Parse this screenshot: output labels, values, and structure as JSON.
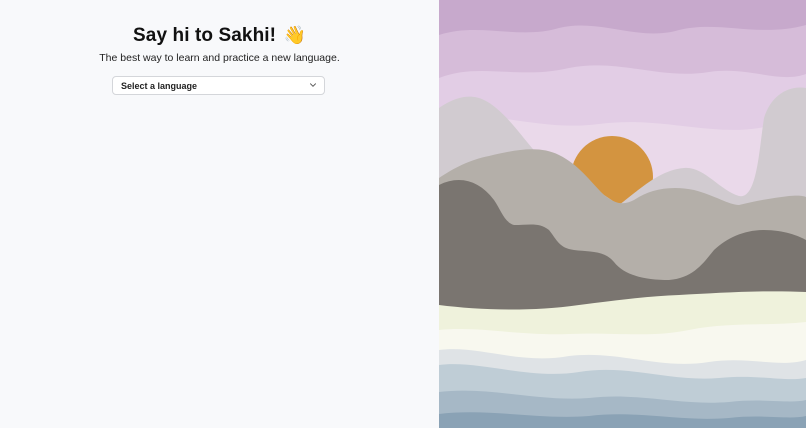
{
  "intro": {
    "title": "Say hi to Sakhi!",
    "wave_emoji": "👋",
    "subtitle": "The best way to learn and practice a new language."
  },
  "language_select": {
    "label": "Select a language",
    "icon": "chevron-down-icon"
  },
  "illustration": {
    "subject": "landscape-illustration",
    "colors": {
      "sky_top": "#c7a9cc",
      "sky_band": "#d6bcd9",
      "sky_light": "#e2cde5",
      "sky_pale": "#ead9ea",
      "sun": "#d39440",
      "mountain_far": "#d1cbd0",
      "mountain_mid": "#b4afa9",
      "mountain_dark": "#7a7570",
      "meadow": "#eff2dc",
      "mist": "#f8f8ef",
      "water_light": "#dfe3e6",
      "water_mid": "#bfcdd6",
      "water_deep": "#a6b8c6",
      "water_deepest": "#8aa2b5"
    }
  }
}
